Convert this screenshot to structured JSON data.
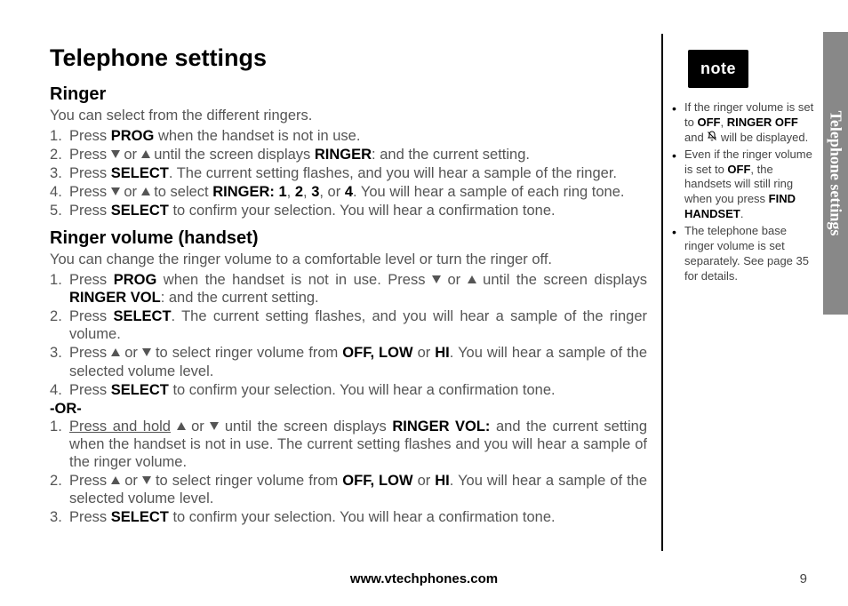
{
  "title": "Telephone settings",
  "sections": {
    "ringer": {
      "heading": "Ringer",
      "intro": "You can select from the different ringers.",
      "steps": [
        {
          "pre": "Press ",
          "b1": "PROG",
          "post1": " when the handset is not in use."
        },
        {
          "pre": "Press ",
          "tri1": "down",
          "mid1": " or ",
          "tri2": "up",
          "mid2": " until the screen displays ",
          "b1": "RINGER",
          "post1": ": and the current setting."
        },
        {
          "pre": "Press ",
          "b1": "SELECT",
          "post1": ". The current setting flashes, and you will hear a sample of the ringer."
        },
        {
          "pre": "Press ",
          "tri1": "down",
          "mid1": " or ",
          "tri2": "up",
          "mid2": " to select ",
          "b1": "RINGER: 1",
          "mid3": ", ",
          "b2": "2",
          "mid4": ", ",
          "b3": "3",
          "mid5": ", or ",
          "b4": "4",
          "post1": ". You will hear a sample of each ring tone."
        },
        {
          "pre": "Press ",
          "b1": "SELECT",
          "post1": " to confirm your selection. You will hear a confirmation tone."
        }
      ]
    },
    "ringer_vol": {
      "heading": "Ringer volume (handset)",
      "intro": "You can change the ringer volume to a comfortable level or turn the ringer off.",
      "stepsA": [
        {
          "pre": "Press ",
          "b1": "PROG",
          "mid1": " when the handset is not in use. Press ",
          "tri1": "down",
          "mid2": " or ",
          "tri2": "up",
          "mid3": " until the screen displays ",
          "b2": "RINGER VOL",
          "post1": ": and the current setting."
        },
        {
          "pre": "Press ",
          "b1": "SELECT",
          "post1": ". The current setting flashes, and you will hear a sample of the ringer volume."
        },
        {
          "pre": "Press ",
          "tri1": "up",
          "mid1": " or ",
          "tri2": "down",
          "mid2": " to select ringer volume from ",
          "b1": "OFF, LOW",
          "mid3": " or ",
          "b2": "HI",
          "post1": ". You will hear a sample of the selected volume level."
        },
        {
          "pre": "Press ",
          "b1": "SELECT",
          "post1": " to confirm your selection. You will hear a confirmation tone."
        }
      ],
      "or": "-OR-",
      "stepsB": [
        {
          "u1": "Press and hold",
          "mid0": " ",
          "tri1": "up",
          "mid1": " or ",
          "tri2": "down",
          "mid2": " until the screen displays ",
          "b1": "RINGER VOL:",
          "post1": " and the current setting when the handset is not in use. The current setting flashes and you will hear a sample of the ringer volume."
        },
        {
          "pre": "Press ",
          "tri1": "up",
          "mid1": " or ",
          "tri2": "down",
          "mid2": " to select ringer volume from ",
          "b1": "OFF, LOW",
          "mid3": " or ",
          "b2": "HI",
          "post1": ". You will hear a sample of the selected volume level."
        },
        {
          "pre": "Press ",
          "b1": "SELECT",
          "post1": " to confirm your selection. You will hear a confirmation tone."
        }
      ]
    }
  },
  "note_badge": "note",
  "notes": [
    {
      "pre": "If the ringer volume is set to ",
      "b1": "OFF",
      "mid1": ", ",
      "b2": "RINGER OFF",
      "mid2": " and ",
      "bell": true,
      "post1": " will be displayed."
    },
    {
      "pre": "Even if the ringer volume is set to ",
      "b1": "OFF",
      "mid1": ", the handsets will still ring when you press ",
      "b2": "FIND HANDSET",
      "post1": "."
    },
    {
      "pre": "The telephone base ringer volume is set separately. See page 35 for details."
    }
  ],
  "sidetab": "Telephone settings",
  "footer": "www.vtechphones.com",
  "page_number": "9"
}
